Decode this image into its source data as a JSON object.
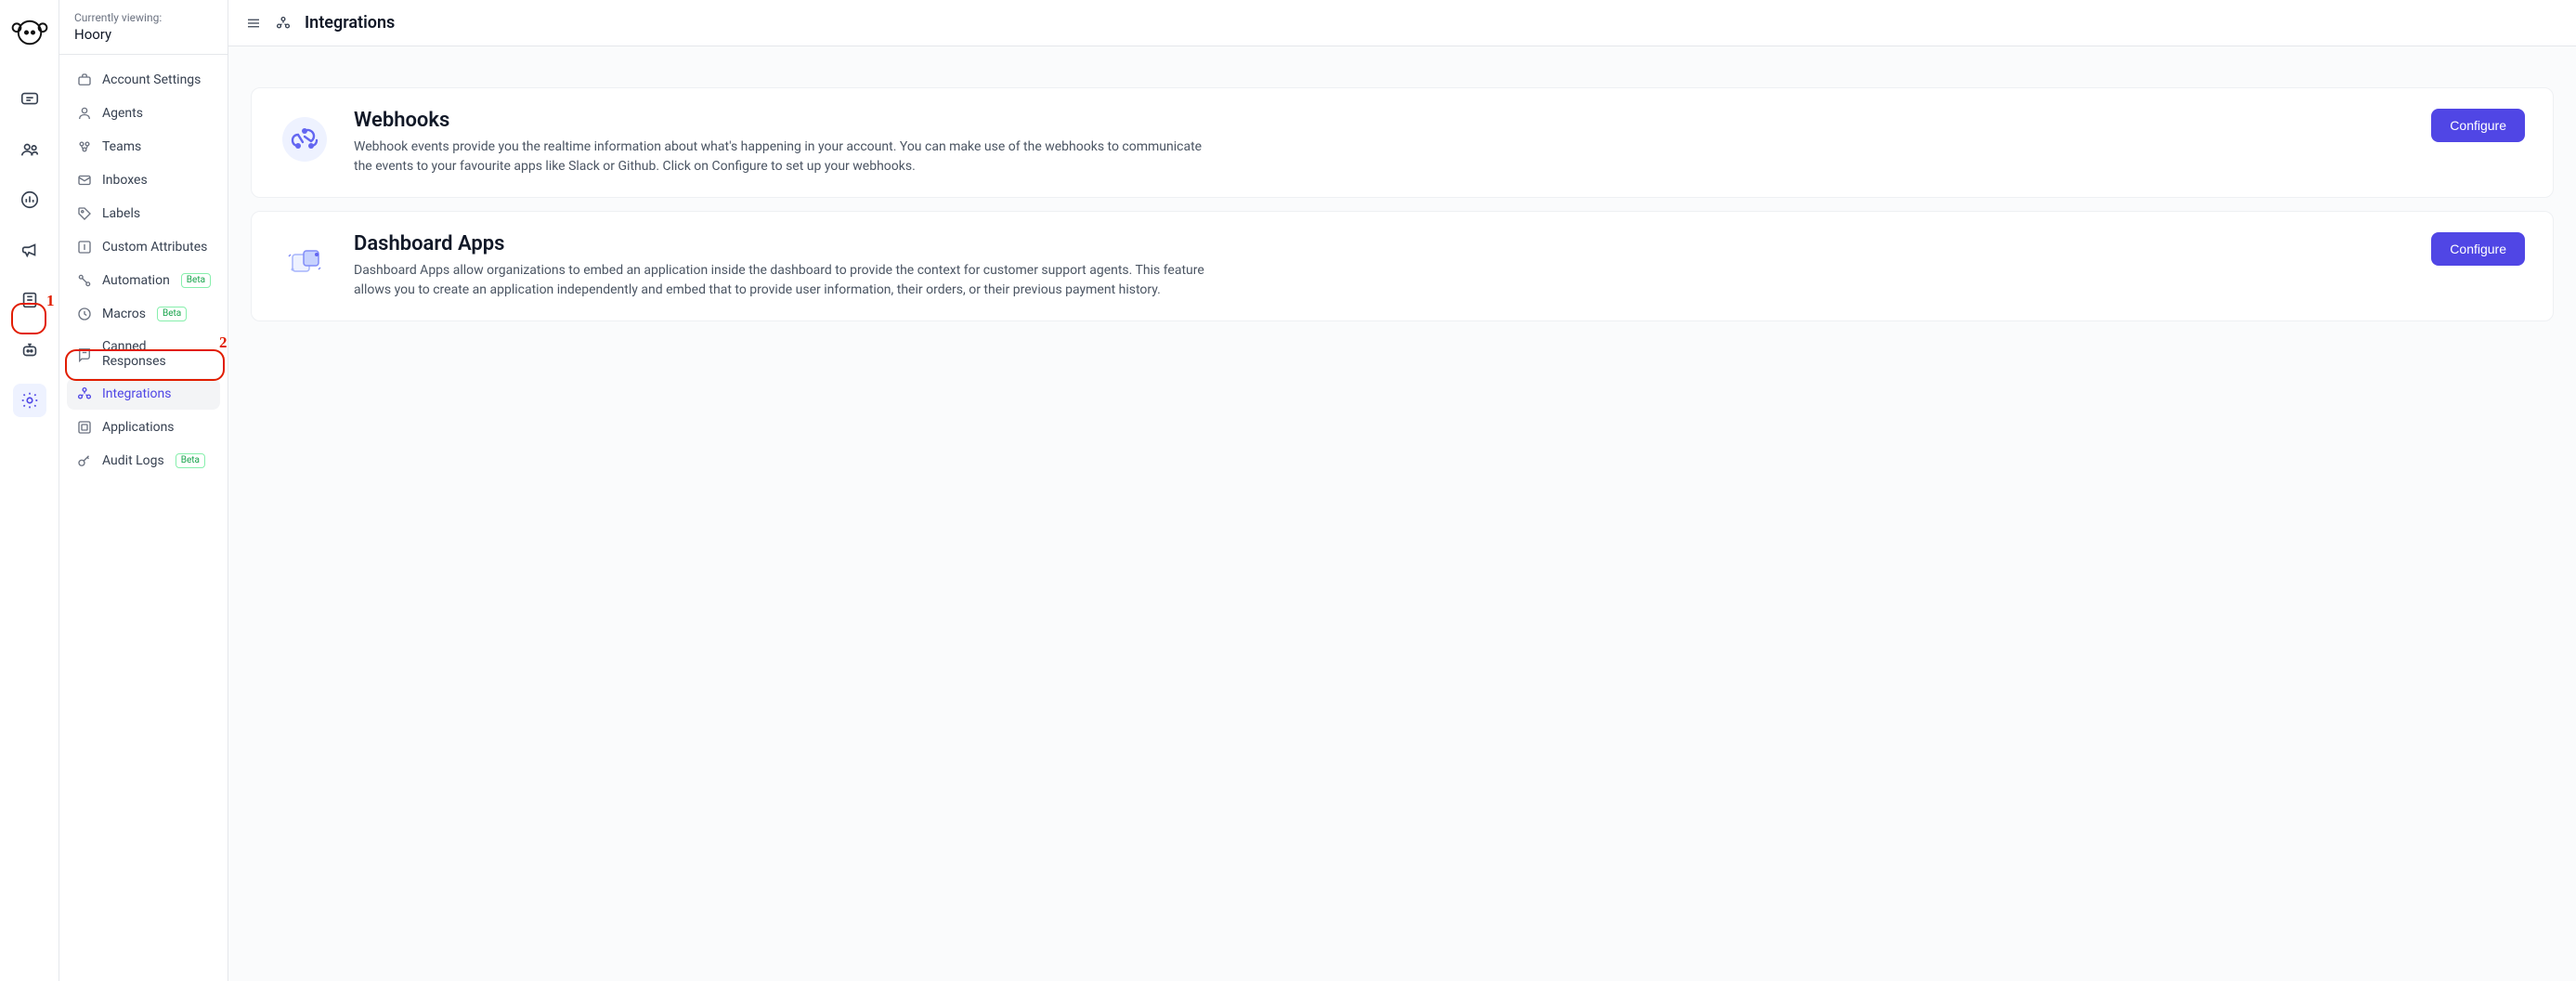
{
  "account": {
    "currently_viewing_label": "Currently viewing:",
    "name": "Hoory"
  },
  "rail": {
    "items": [
      {
        "id": "conversations",
        "icon": "chat"
      },
      {
        "id": "contacts",
        "icon": "people"
      },
      {
        "id": "reports",
        "icon": "bars"
      },
      {
        "id": "campaigns",
        "icon": "megaphone"
      },
      {
        "id": "help-center",
        "icon": "book"
      },
      {
        "id": "bot",
        "icon": "bot"
      },
      {
        "id": "settings",
        "icon": "gear",
        "active": true
      }
    ]
  },
  "sidebar": {
    "items": [
      {
        "id": "account-settings",
        "label": "Account Settings",
        "icon": "briefcase"
      },
      {
        "id": "agents",
        "label": "Agents",
        "icon": "person"
      },
      {
        "id": "teams",
        "label": "Teams",
        "icon": "teams"
      },
      {
        "id": "inboxes",
        "label": "Inboxes",
        "icon": "inbox"
      },
      {
        "id": "labels",
        "label": "Labels",
        "icon": "tag"
      },
      {
        "id": "custom-attributes",
        "label": "Custom Attributes",
        "icon": "attr"
      },
      {
        "id": "automation",
        "label": "Automation",
        "icon": "automation",
        "badge": "Beta"
      },
      {
        "id": "macros",
        "label": "Macros",
        "icon": "macros",
        "badge": "Beta"
      },
      {
        "id": "canned-responses",
        "label": "Canned Responses",
        "icon": "canned"
      },
      {
        "id": "integrations",
        "label": "Integrations",
        "icon": "integrations",
        "active": true
      },
      {
        "id": "applications",
        "label": "Applications",
        "icon": "apps"
      },
      {
        "id": "audit-logs",
        "label": "Audit Logs",
        "icon": "key",
        "badge": "Beta"
      }
    ]
  },
  "page": {
    "title": "Integrations"
  },
  "integrations": [
    {
      "id": "webhooks",
      "title": "Webhooks",
      "description": "Webhook events provide you the realtime information about what's happening in your account. You can make use of the webhooks to communicate the events to your favourite apps like Slack or Github. Click on Configure to set up your webhooks.",
      "button": "Configure",
      "icon": "webhook"
    },
    {
      "id": "dashboard-apps",
      "title": "Dashboard Apps",
      "description": "Dashboard Apps allow organizations to embed an application inside the dashboard to provide the context for customer support agents. This feature allows you to create an application independently and embed that to provide user information, their orders, or their previous payment history.",
      "button": "Configure",
      "icon": "puzzle"
    }
  ],
  "annotations": {
    "setting_number": "1",
    "integrations_number": "2"
  }
}
